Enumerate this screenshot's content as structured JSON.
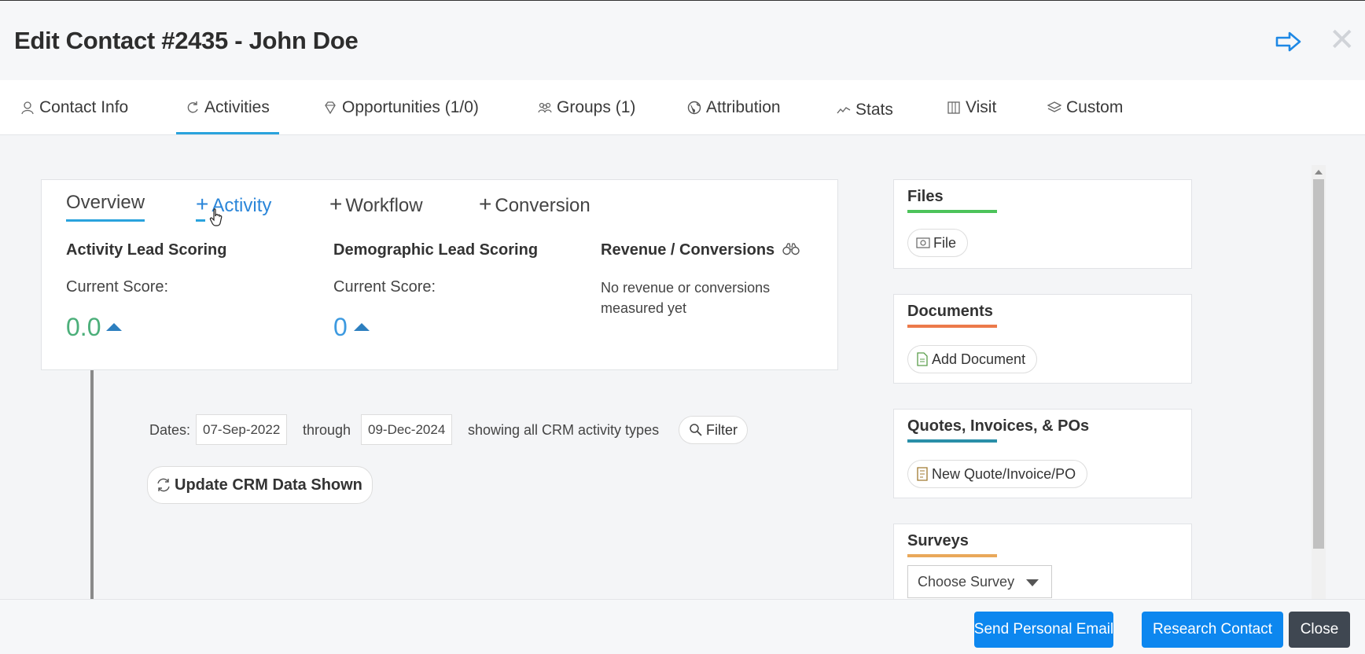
{
  "header": {
    "title": "Edit Contact #2435 - John Doe"
  },
  "tabs": [
    {
      "label": "Contact Info",
      "icon": "user-icon"
    },
    {
      "label": "Activities",
      "icon": "refresh-icon"
    },
    {
      "label": "Opportunities (1/0)",
      "icon": "diamond-icon"
    },
    {
      "label": "Groups (1)",
      "icon": "group-icon"
    },
    {
      "label": "Attribution",
      "icon": "globe-icon"
    },
    {
      "label": "Stats",
      "icon": "trend-icon"
    },
    {
      "label": "Visit",
      "icon": "map-icon"
    },
    {
      "label": "Custom",
      "icon": "layers-icon"
    }
  ],
  "overview": {
    "subtabs": [
      "Overview",
      "Activity",
      "Workflow",
      "Conversion"
    ],
    "activity_scoring": {
      "heading": "Activity Lead Scoring",
      "label": "Current Score:",
      "value": "0.0"
    },
    "demographic_scoring": {
      "heading": "Demographic Lead Scoring",
      "label": "Current Score:",
      "value": "0"
    },
    "revenue": {
      "heading": "Revenue / Conversions",
      "text": "No revenue or conversions measured yet"
    }
  },
  "filters": {
    "dates_label": "Dates:",
    "start_date": "07-Sep-2022",
    "through_label": "through",
    "end_date": "09-Dec-2024",
    "showing_text": "showing all CRM activity types",
    "filter_label": "Filter",
    "update_label": "Update CRM Data Shown"
  },
  "side": {
    "files": {
      "title": "Files",
      "button": "File",
      "color": "#4cc35a"
    },
    "documents": {
      "title": "Documents",
      "button": "Add Document",
      "color": "#ec7a4a"
    },
    "quotes": {
      "title": "Quotes, Invoices, & POs",
      "button": "New Quote/Invoice/PO",
      "color": "#2a8fa8"
    },
    "surveys": {
      "title": "Surveys",
      "select": "Choose Survey",
      "color": "#e9a85a"
    }
  },
  "footer": {
    "send_email": "Send Personal Email",
    "research": "Research Contact",
    "close": "Close"
  },
  "colors": {
    "accent": "#2aa3dd",
    "primary_button": "#0d87ef",
    "dark_button": "#3f4751"
  }
}
